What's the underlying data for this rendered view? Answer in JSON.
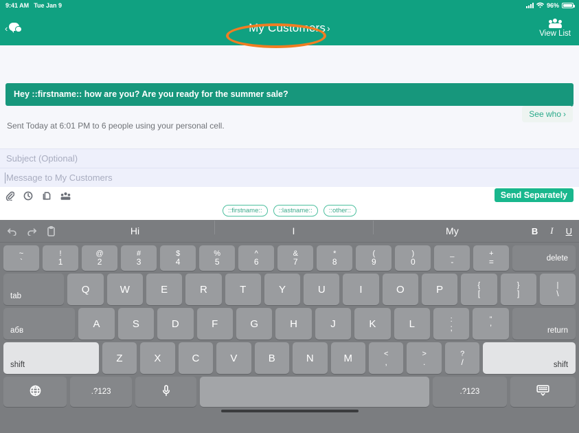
{
  "status_bar": {
    "time": "9:41 AM",
    "date": "Tue Jan 9",
    "battery_percent": "96%",
    "signal_icon": "cellular-signal-icon",
    "wifi_icon": "wifi-icon",
    "battery_icon": "battery-icon"
  },
  "header": {
    "back_icon": "back-chevron-icon",
    "messages_icon": "chat-bubbles-icon",
    "title": "My Customers",
    "title_chevron": "›",
    "view_list_label": "View List",
    "view_list_icon": "people-group-icon",
    "annotation": "orange-ellipse-highlight",
    "brand_green": "#10a181",
    "annotation_color": "#f07d22"
  },
  "conversation": {
    "message_text": "Hey ::firstname:: how are you? Are you ready for the summer sale?",
    "sent_status": "Sent Today at 6:01 PM to 6 people using your personal cell.",
    "see_who_label": "See who",
    "see_who_chevron": "›",
    "bubble_color": "#17977c"
  },
  "compose": {
    "subject_placeholder": "Subject (Optional)",
    "message_placeholder": "Message to My Customers",
    "send_button_label": "Send Separately",
    "send_button_color": "#19b78d",
    "toolbar_icons": [
      {
        "name": "attachment-paperclip-icon"
      },
      {
        "name": "schedule-clock-icon"
      },
      {
        "name": "templates-icon"
      },
      {
        "name": "recipients-group-icon"
      }
    ],
    "merge_tags": [
      "::firstname::",
      "::lastname::",
      "::other::"
    ]
  },
  "keyboard": {
    "predictive": {
      "undo_icon": "undo-arrow-icon",
      "redo_icon": "redo-arrow-icon",
      "paste_icon": "paste-clipboard-icon",
      "suggestions": [
        "Hi",
        "I",
        "My"
      ],
      "format_bold": "B",
      "format_italic": "I",
      "format_underline": "U"
    },
    "rows": {
      "numbers": [
        {
          "top": "~",
          "bot": "`"
        },
        {
          "top": "!",
          "bot": "1"
        },
        {
          "top": "@",
          "bot": "2"
        },
        {
          "top": "#",
          "bot": "3"
        },
        {
          "top": "$",
          "bot": "4"
        },
        {
          "top": "%",
          "bot": "5"
        },
        {
          "top": "^",
          "bot": "6"
        },
        {
          "top": "&",
          "bot": "7"
        },
        {
          "top": "*",
          "bot": "8"
        },
        {
          "top": "(",
          "bot": "9"
        },
        {
          "top": ")",
          "bot": "0"
        },
        {
          "top": "_",
          "bot": "-"
        },
        {
          "top": "+",
          "bot": "="
        }
      ],
      "delete_label": "delete",
      "tab_label": "tab",
      "qwerty": [
        "Q",
        "W",
        "E",
        "R",
        "T",
        "Y",
        "U",
        "I",
        "O",
        "P"
      ],
      "qwerty_extra": [
        {
          "top": "{",
          "bot": "["
        },
        {
          "top": "}",
          "bot": "]"
        },
        {
          "top": "|",
          "bot": "\\"
        }
      ],
      "caps_label": "абв",
      "home": [
        "A",
        "S",
        "D",
        "F",
        "G",
        "H",
        "J",
        "K",
        "L"
      ],
      "home_extra": [
        {
          "top": ":",
          "bot": ";"
        },
        {
          "top": "”",
          "bot": "’"
        }
      ],
      "return_label": "return",
      "shift_left_label": "shift",
      "shift_right_label": "shift",
      "bottom_letters": [
        "Z",
        "X",
        "C",
        "V",
        "B",
        "N",
        "M"
      ],
      "bottom_extra": [
        {
          "top": "<",
          "bot": ","
        },
        {
          "top": ">",
          "bot": "."
        },
        {
          "top": "?",
          "bot": "/"
        }
      ],
      "globe_icon": "globe-language-icon",
      "numeric_left_label": ".?123",
      "mic_icon": "microphone-icon",
      "space_label": "",
      "numeric_right_label": ".?123",
      "hide_keyboard_icon": "hide-keyboard-icon"
    }
  }
}
